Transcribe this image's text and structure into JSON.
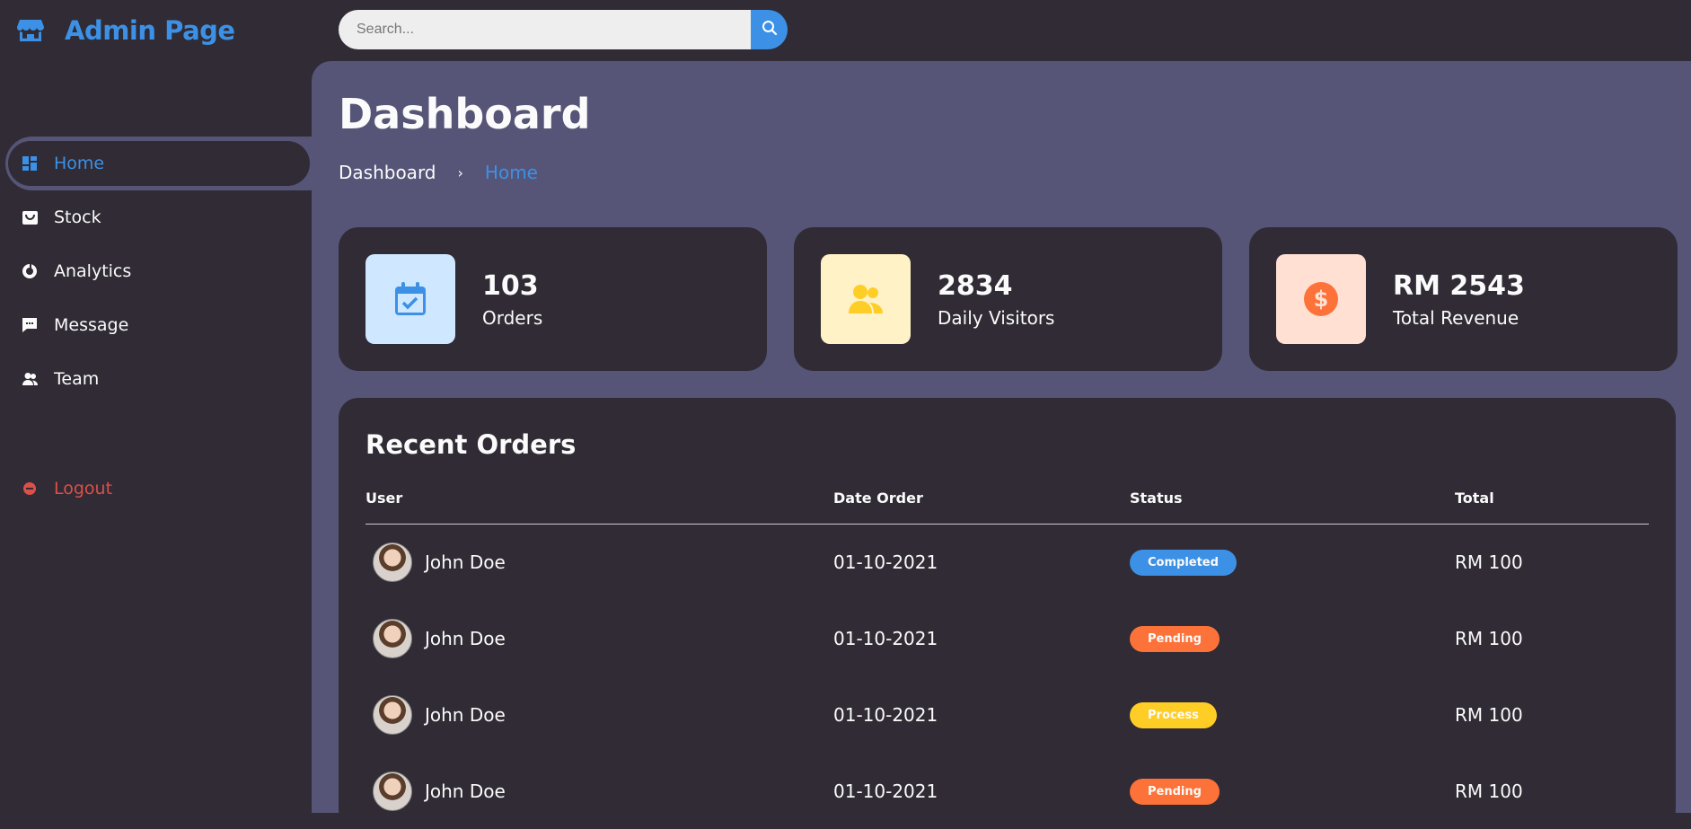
{
  "brand": {
    "title": "Admin Page",
    "icon": "store-icon",
    "color": "#3c91e6"
  },
  "search": {
    "placeholder": "Search...",
    "value": ""
  },
  "sidebar": {
    "items": [
      {
        "label": "Home",
        "icon": "dashboard-icon",
        "active": true
      },
      {
        "label": "Stock",
        "icon": "shopping-bag-icon",
        "active": false
      },
      {
        "label": "Analytics",
        "icon": "doughnut-chart-icon",
        "active": false
      },
      {
        "label": "Message",
        "icon": "message-icon",
        "active": false
      },
      {
        "label": "Team",
        "icon": "group-icon",
        "active": false
      }
    ],
    "logout": {
      "label": "Logout",
      "icon": "logout-icon",
      "color": "#db504a"
    }
  },
  "main": {
    "title": "Dashboard",
    "breadcrumb": {
      "first": "Dashboard",
      "separator": "›",
      "current": "Home"
    }
  },
  "cards": [
    {
      "value": "103",
      "label": "Orders",
      "icon": "calendar-check-icon",
      "icon_bg": "#cfe8ff",
      "icon_color": "#3c91e6"
    },
    {
      "value": "2834",
      "label": "Daily Visitors",
      "icon": "group-icon",
      "icon_bg": "#fff2c6",
      "icon_color": "#ffce26"
    },
    {
      "value": "RM 2543",
      "label": "Total Revenue",
      "icon": "dollar-circle-icon",
      "icon_bg": "#ffe0d3",
      "icon_color": "#fd7238"
    }
  ],
  "orders": {
    "title": "Recent Orders",
    "columns": [
      "User",
      "Date Order",
      "Status",
      "Total"
    ],
    "rows": [
      {
        "user": "John Doe",
        "date": "01-10-2021",
        "status": "Completed",
        "status_color": "#3c91e6",
        "total": "RM 100"
      },
      {
        "user": "John Doe",
        "date": "01-10-2021",
        "status": "Pending",
        "status_color": "#fd7238",
        "total": "RM 100"
      },
      {
        "user": "John Doe",
        "date": "01-10-2021",
        "status": "Process",
        "status_color": "#ffce26",
        "total": "RM 100"
      },
      {
        "user": "John Doe",
        "date": "01-10-2021",
        "status": "Pending",
        "status_color": "#fd7238",
        "total": "RM 100"
      }
    ]
  }
}
